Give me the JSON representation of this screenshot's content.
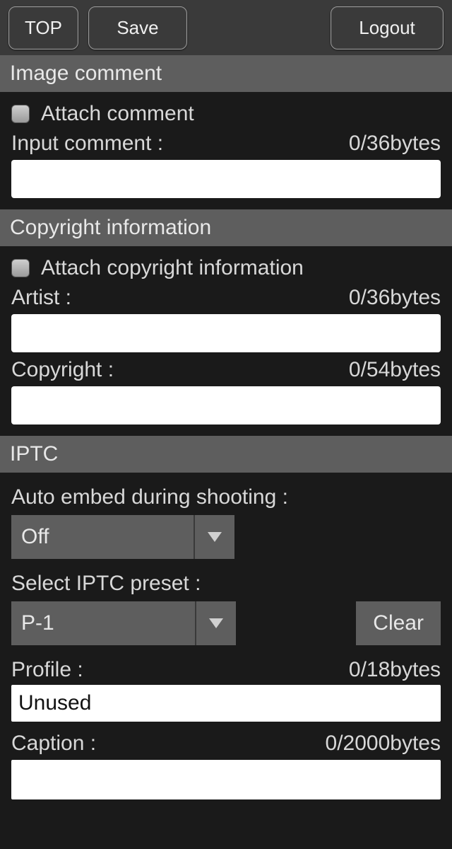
{
  "toolbar": {
    "top_label": "TOP",
    "save_label": "Save",
    "logout_label": "Logout"
  },
  "image_comment": {
    "header": "Image comment",
    "attach_label": "Attach comment",
    "input_label": "Input comment :",
    "input_counter": "0/36bytes",
    "input_value": ""
  },
  "copyright": {
    "header": "Copyright information",
    "attach_label": "Attach copyright information",
    "artist_label": "Artist :",
    "artist_counter": "0/36bytes",
    "artist_value": "",
    "copyright_label": "Copyright :",
    "copyright_counter": "0/54bytes",
    "copyright_value": ""
  },
  "iptc": {
    "header": "IPTC",
    "auto_embed_label": "Auto embed during shooting :",
    "auto_embed_value": "Off",
    "select_preset_label": "Select IPTC preset :",
    "select_preset_value": "P-1",
    "clear_label": "Clear",
    "profile_label": "Profile :",
    "profile_counter": "0/18bytes",
    "profile_value": "Unused",
    "caption_label": "Caption :",
    "caption_counter": "0/2000bytes",
    "caption_value": ""
  }
}
